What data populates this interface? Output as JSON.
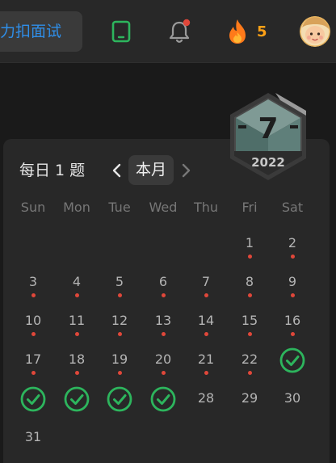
{
  "header": {
    "interview_label": "力扣面试",
    "streak_count": "5",
    "colors": {
      "accent": "#2f8ee8",
      "streak": "#ffa116",
      "notification": "#e0473a",
      "device": "#2db55d"
    },
    "icons": [
      "tablet-icon",
      "bell-icon",
      "flame-icon",
      "avatar"
    ]
  },
  "calendar": {
    "title": "每日 1 题",
    "month_label": "本月",
    "badge": {
      "number": "7",
      "year": "2022"
    },
    "weekdays": [
      "Sun",
      "Mon",
      "Tue",
      "Wed",
      "Thu",
      "Fri",
      "Sat"
    ],
    "days": [
      {
        "label": "1",
        "status": "dot"
      },
      {
        "label": "2",
        "status": "dot"
      },
      {
        "label": "3",
        "status": "dot"
      },
      {
        "label": "4",
        "status": "dot"
      },
      {
        "label": "5",
        "status": "dot"
      },
      {
        "label": "6",
        "status": "dot"
      },
      {
        "label": "7",
        "status": "dot"
      },
      {
        "label": "8",
        "status": "dot"
      },
      {
        "label": "9",
        "status": "dot"
      },
      {
        "label": "10",
        "status": "dot"
      },
      {
        "label": "11",
        "status": "dot"
      },
      {
        "label": "12",
        "status": "dot"
      },
      {
        "label": "13",
        "status": "dot"
      },
      {
        "label": "14",
        "status": "dot"
      },
      {
        "label": "15",
        "status": "dot"
      },
      {
        "label": "16",
        "status": "dot"
      },
      {
        "label": "17",
        "status": "dot"
      },
      {
        "label": "18",
        "status": "dot"
      },
      {
        "label": "19",
        "status": "dot"
      },
      {
        "label": "20",
        "status": "dot"
      },
      {
        "label": "21",
        "status": "dot"
      },
      {
        "label": "22",
        "status": "dot"
      },
      {
        "label": "23",
        "status": "done"
      },
      {
        "label": "24",
        "status": "done"
      },
      {
        "label": "25",
        "status": "done"
      },
      {
        "label": "26",
        "status": "done"
      },
      {
        "label": "27",
        "status": "done"
      },
      {
        "label": "28",
        "status": "none"
      },
      {
        "label": "29",
        "status": "none"
      },
      {
        "label": "30",
        "status": "none"
      },
      {
        "label": "31",
        "status": "none"
      }
    ],
    "colors": {
      "dot": "#e0473a",
      "done": "#2db55d"
    }
  }
}
